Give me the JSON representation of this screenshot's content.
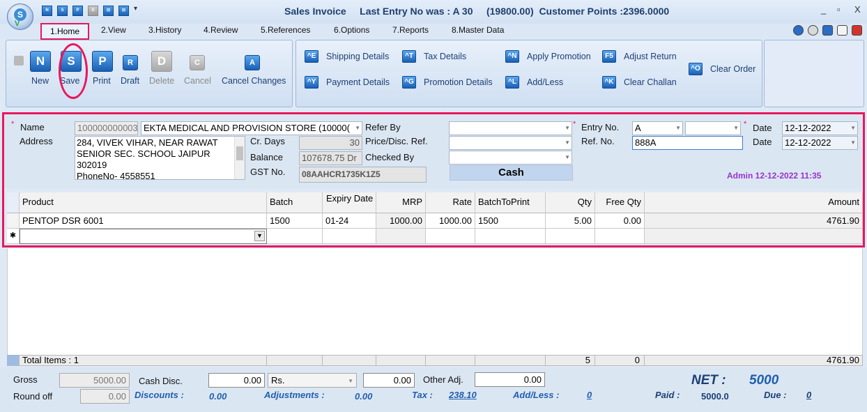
{
  "titlebar": {
    "title": "Sales Invoice     Last Entry No was : A 30     (19800.00)  Customer Points :2396.0000",
    "quick_icons": [
      "N",
      "S",
      "P",
      "D",
      "⊟",
      "⊟"
    ],
    "minimize": "_",
    "restore": "▫",
    "close": "X"
  },
  "tabs": [
    "1.Home",
    "2.View",
    "3.History",
    "4.Review",
    "5.References",
    "6.Options",
    "7.Reports",
    "8.Master Data"
  ],
  "ribbon": {
    "main_buttons": [
      {
        "icon": "N",
        "label": "New"
      },
      {
        "icon": "S",
        "label": "Save"
      },
      {
        "icon": "P",
        "label": "Print"
      },
      {
        "icon": "R",
        "label": "Draft"
      },
      {
        "icon": "D",
        "label": "Delete"
      },
      {
        "icon": "C",
        "label": "Cancel"
      },
      {
        "icon": "A",
        "label": "Cancel Changes"
      }
    ],
    "actions": [
      {
        "icon": "^E",
        "label": "Shipping Details"
      },
      {
        "icon": "^T",
        "label": "Tax Details"
      },
      {
        "icon": "^N",
        "label": "Apply Promotion"
      },
      {
        "icon": "F5",
        "label": "Adjust Return"
      },
      {
        "icon": "^O",
        "label": "Clear Order"
      },
      {
        "icon": "^Y",
        "label": "Payment Details"
      },
      {
        "icon": "^G",
        "label": "Promotion Details"
      },
      {
        "icon": "^L",
        "label": "Add/Less"
      },
      {
        "icon": "^K",
        "label": "Clear Challan"
      }
    ]
  },
  "form": {
    "required_marker": "*",
    "name_label": "Name",
    "customer_code": "100000000003",
    "customer_name": "EKTA MEDICAL AND PROVISION STORE (10000(",
    "address_label": "Address",
    "address_lines": [
      "284, VIVEK VIHAR, NEAR RAWAT",
      "SENIOR  SEC. SCHOOL JAIPUR",
      "302019",
      "PhoneNo- 4558551"
    ],
    "cr_days_label": "Cr. Days",
    "cr_days": "30",
    "balance_label": "Balance",
    "balance": "107678.75 Dr",
    "gst_label": "GST No.",
    "gst_no": "08AAHCR1735K1Z5",
    "refer_by_label": "Refer By",
    "price_disc_label": "Price/Disc. Ref.",
    "checked_by_label": "Checked By",
    "payment_mode": "Cash",
    "entry_no_label": "Entry No.",
    "entry_series": "A",
    "entry_no": "",
    "ref_no_label": "Ref. No.",
    "ref_no": "888A",
    "date_label": "Date",
    "date1": "12-12-2022",
    "date2": "12-12-2022",
    "admin_stamp": "Admin 12-12-2022 11:35"
  },
  "grid": {
    "columns": [
      "Product",
      "Batch",
      "Expiry Date",
      "MRP",
      "Rate",
      "BatchToPrint",
      "Qty",
      "Free Qty",
      "Amount"
    ],
    "rows": [
      {
        "product": "PENTOP DSR 6001",
        "batch": "1500",
        "expiry": "01-24",
        "mrp": "1000.00",
        "rate": "1000.00",
        "batch_to_print": "1500",
        "qty": "5.00",
        "free_qty": "0.00",
        "amount": "4761.90"
      }
    ],
    "new_row_marker": "✱",
    "totals": {
      "label": "Total Items : 1",
      "qty": "5",
      "free_qty": "0",
      "amount": "4761.90"
    }
  },
  "footer": {
    "gross_label": "Gross",
    "gross": "5000.00",
    "cash_disc_label": "Cash Disc.",
    "cash_disc": "0.00",
    "cash_disc_type": "Rs.",
    "cash_disc_amount": "0.00",
    "other_adj_label": "Other Adj.",
    "other_adj": "0.00",
    "round_off_label": "Round off",
    "round_off": "0.00",
    "discounts_label": "Discounts :",
    "discounts": "0.00",
    "adjustments_label": "Adjustments :",
    "adjustments": "0.00",
    "tax_label": "Tax :",
    "tax": "238.10",
    "add_less_label": "Add/Less :",
    "add_less": "0",
    "net_label": "NET :",
    "net": "5000",
    "paid_label": "Paid :",
    "paid": "5000.0",
    "due_label": "Due :",
    "due": "0"
  }
}
